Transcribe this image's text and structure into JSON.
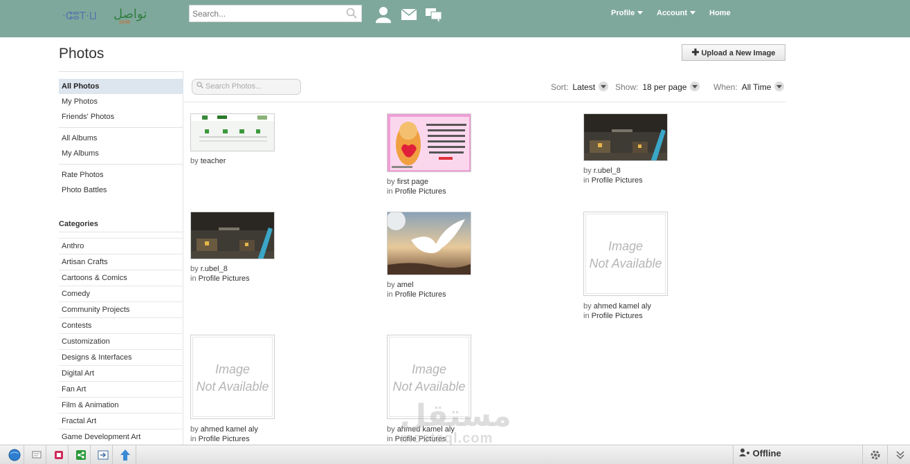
{
  "header": {
    "logo_text": "تواصل",
    "search_placeholder": "Search...",
    "nav": [
      {
        "label": "Profile",
        "has_menu": true
      },
      {
        "label": "Account",
        "has_menu": true
      },
      {
        "label": "Home",
        "has_menu": false
      }
    ]
  },
  "page": {
    "title": "Photos",
    "upload_label": "Upload a New Image"
  },
  "sidebar": {
    "groups": [
      [
        {
          "label": "All Photos",
          "active": true
        },
        {
          "label": "My Photos"
        },
        {
          "label": "Friends' Photos"
        }
      ],
      [
        {
          "label": "All Albums"
        },
        {
          "label": "My Albums"
        }
      ],
      [
        {
          "label": "Rate Photos"
        },
        {
          "label": "Photo Battles"
        }
      ]
    ],
    "categories_heading": "Categories",
    "categories": [
      "Anthro",
      "Artisan Crafts",
      "Cartoons & Comics",
      "Comedy",
      "Community Projects",
      "Contests",
      "Customization",
      "Designs & Interfaces",
      "Digital Art",
      "Fan Art",
      "Film & Animation",
      "Fractal Art",
      "Game Development Art"
    ]
  },
  "filters": {
    "search_placeholder": "Search Photos...",
    "sort_label": "Sort:",
    "sort_value": "Latest",
    "show_label": "Show:",
    "show_value": "18 per page",
    "when_label": "When:",
    "when_value": "All Time"
  },
  "photos": [
    {
      "by_prefix": "by",
      "author": "teacher",
      "in_prefix": "",
      "album": "",
      "kind": "screenshot"
    },
    {
      "by_prefix": "by",
      "author": "first page",
      "in_prefix": "in",
      "album": "Profile Pictures",
      "kind": "card"
    },
    {
      "by_prefix": "by",
      "author": "r.ubel_8",
      "in_prefix": "in",
      "album": "Profile Pictures",
      "kind": "game"
    },
    {
      "by_prefix": "by",
      "author": "r.ubel_8",
      "in_prefix": "in",
      "album": "Profile Pictures",
      "kind": "game"
    },
    {
      "by_prefix": "by",
      "author": "amel",
      "in_prefix": "in",
      "album": "Profile Pictures",
      "kind": "dove"
    },
    {
      "by_prefix": "by",
      "author": "ahmed kamel aly",
      "in_prefix": "in",
      "album": "Profile Pictures",
      "kind": "na"
    },
    {
      "by_prefix": "by",
      "author": "ahmed kamel aly",
      "in_prefix": "in",
      "album": "Profile Pictures",
      "kind": "na"
    },
    {
      "by_prefix": "by",
      "author": "ahmed kamel aly",
      "in_prefix": "in",
      "album": "Profile Pictures",
      "kind": "na"
    }
  ],
  "placeholder": {
    "line1": "Image",
    "line2": "Not Available"
  },
  "watermark": {
    "line1": "مستقل",
    "line2": "mostaql.com"
  },
  "taskbar": {
    "status": "Offline"
  },
  "colors": {
    "header_bg": "#7fa89c",
    "active_item_bg": "#dde5ee"
  }
}
